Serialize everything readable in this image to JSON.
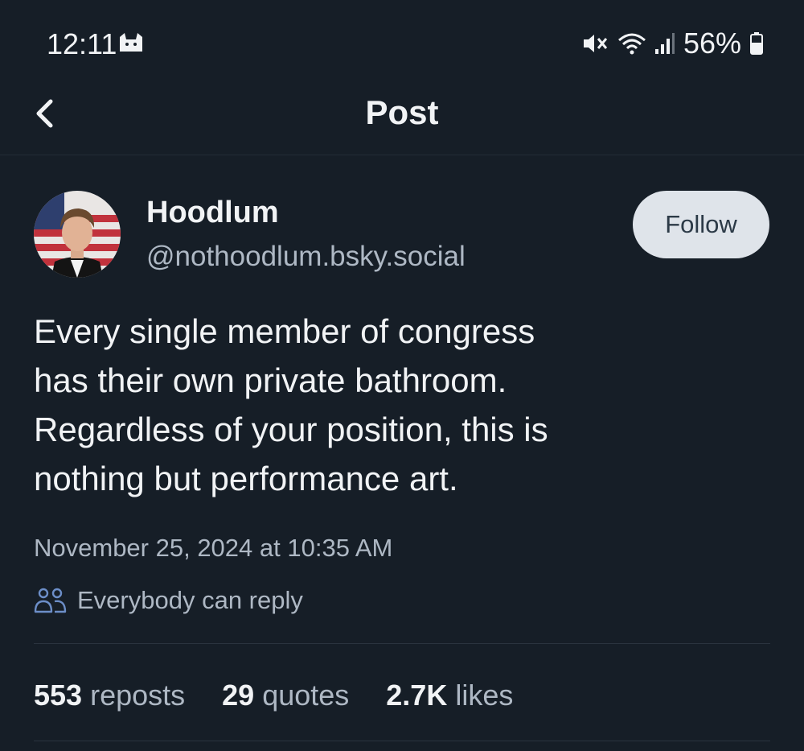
{
  "status_bar": {
    "time": "12:11",
    "app_icon": "cat-icon",
    "icons": [
      "mute-icon",
      "wifi-icon",
      "signal-icon",
      "battery-icon"
    ],
    "battery_percent": "56%"
  },
  "nav": {
    "back_icon": "chevron-left-icon",
    "title": "Post"
  },
  "post": {
    "author": {
      "display_name": "Hoodlum",
      "handle": "@nothoodlum.bsky.social"
    },
    "follow_label": "Follow",
    "text_lines": [
      "Every single member of congress",
      "has their own private bathroom.",
      "Regardless of your position, this is",
      "nothing but performance art."
    ],
    "timestamp": "November 25, 2024 at 10:35 AM",
    "reply_setting": "Everybody can reply",
    "stats": [
      {
        "count": "553",
        "label": "reposts"
      },
      {
        "count": "29",
        "label": "quotes"
      },
      {
        "count": "2.7K",
        "label": "likes"
      }
    ]
  },
  "colors": {
    "background": "#161e27",
    "text_primary": "#f1f3f5",
    "text_secondary": "#aeb8c4",
    "follow_button_bg": "#dfe4ea",
    "reply_icon": "#6c8ec8"
  }
}
